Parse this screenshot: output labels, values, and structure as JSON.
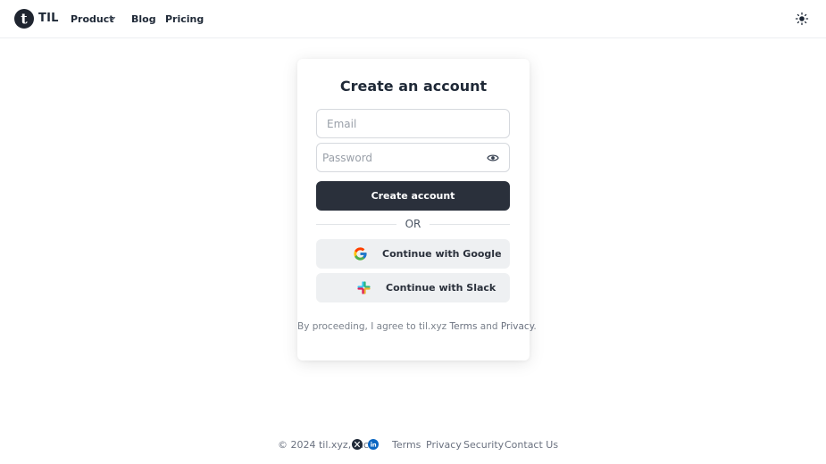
{
  "header": {
    "logo_letter": "t",
    "brand": "TIL",
    "nav": {
      "product": "Product",
      "blog": "Blog",
      "pricing": "Pricing"
    },
    "icons": {
      "product_chevron": "chevron-down-icon",
      "theme_toggle": "sun-icon"
    }
  },
  "signup": {
    "title": "Create an account",
    "email_placeholder": "Email",
    "email_value": "",
    "password_placeholder": "Password",
    "password_value": "",
    "password_toggle_icon": "eye-icon",
    "submit_label": "Create account",
    "divider_text": "OR",
    "google_label": "Continue with Google",
    "slack_label": "Continue with Slack",
    "legal": {
      "prefix": "By proceeding, I agree to til.xyz ",
      "terms": "Terms",
      "and": " and ",
      "privacy": "Privacy",
      "suffix": "."
    }
  },
  "footer": {
    "copyright": "© 2024 til.xyz, Inc.",
    "social_icons": [
      "x-icon",
      "linkedin-icon"
    ],
    "links": {
      "terms": "Terms",
      "privacy": "Privacy",
      "security": "Security",
      "contact": "Contact Us"
    }
  },
  "colors": {
    "primary_button": "#2a303b",
    "social_button": "#eef0f2",
    "text": "#1f2937",
    "muted": "#6b7280",
    "linkedin": "#0a66c2"
  }
}
